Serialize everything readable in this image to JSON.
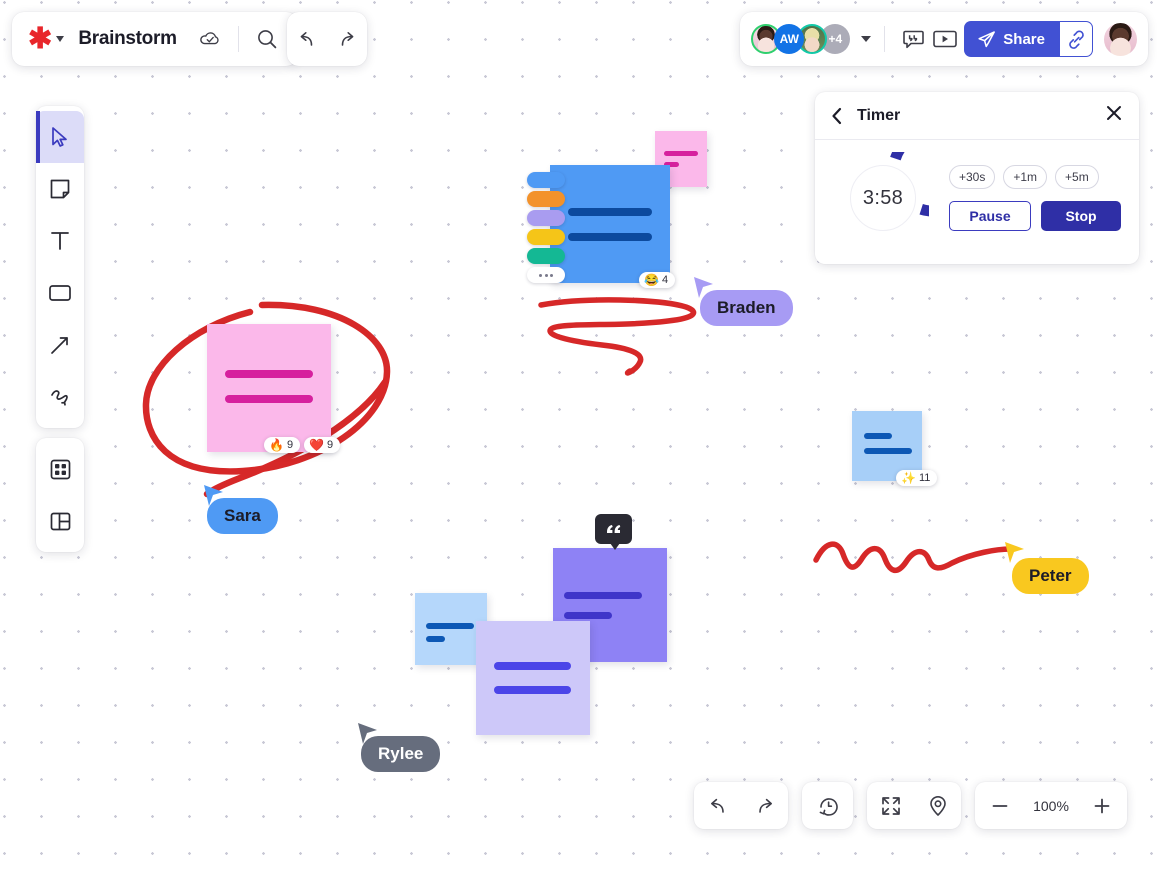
{
  "topbar": {
    "logo_icon": "asterisk-logo",
    "dropdown_icon": "chevron-down-icon",
    "title": "Brainstorm",
    "cloud_icon": "cloud-check-icon",
    "search_icon": "search-icon",
    "undo_icon": "undo-icon",
    "redo_icon": "redo-icon"
  },
  "collaborators": {
    "avatars": [
      {
        "name": "avatar-1",
        "initials": "",
        "type": "photo",
        "ring": "#2fcf6e"
      },
      {
        "name": "avatar-2",
        "initials": "AW",
        "type": "initials",
        "ring": "#1273e6"
      },
      {
        "name": "avatar-3",
        "initials": "",
        "type": "photo",
        "ring": "#12c9a8"
      },
      {
        "name": "avatar-more",
        "initials": "+4",
        "type": "count",
        "ring": "#acacb8"
      }
    ],
    "overflow_label": "+4",
    "dropdown_icon": "chevron-down-icon",
    "comment_icon": "comment-icon",
    "present_icon": "present-play-icon",
    "share_label": "Share",
    "share_icon": "paper-plane-icon",
    "link_icon": "link-icon",
    "share_color": "#4151d3",
    "me_avatar": "current-user-avatar"
  },
  "tools": {
    "primary": [
      {
        "name": "select-tool",
        "icon": "cursor-icon",
        "active": true
      },
      {
        "name": "sticky-note-tool",
        "icon": "sticky-note-icon",
        "active": false
      },
      {
        "name": "text-tool",
        "icon": "text-icon",
        "active": false
      },
      {
        "name": "shape-tool",
        "icon": "rectangle-icon",
        "active": false
      },
      {
        "name": "line-tool",
        "icon": "arrow-icon",
        "active": false
      },
      {
        "name": "pen-tool",
        "icon": "pen-scribble-icon",
        "active": false
      }
    ],
    "secondary": [
      {
        "name": "apps-tool",
        "icon": "grid-apps-icon"
      },
      {
        "name": "templates-tool",
        "icon": "template-layout-icon"
      }
    ]
  },
  "timer": {
    "back_icon": "chevron-left-icon",
    "title": "Timer",
    "close_icon": "close-icon",
    "value": "3:58",
    "ring_color": "#2f2fa6",
    "chips": [
      "+30s",
      "+1m",
      "+5m"
    ],
    "pause_label": "Pause",
    "stop_label": "Stop"
  },
  "canvas": {
    "reactions": [
      {
        "name": "reaction-laugh",
        "emoji": "😂",
        "count": "4"
      },
      {
        "name": "reaction-fire",
        "emoji": "🔥",
        "count": "9"
      },
      {
        "name": "reaction-heart",
        "emoji": "❤️",
        "count": "9"
      },
      {
        "name": "reaction-sparkle",
        "emoji": "✨",
        "count": "11"
      }
    ],
    "color_swatches": [
      "#4f9af4",
      "#f3922b",
      "#a99cf0",
      "#f5c518",
      "#14b894"
    ],
    "more_swatch_icon": "more-dots-icon",
    "comment_icon": "quote-comment-icon",
    "cursors": [
      {
        "name": "cursor-braden",
        "label": "Braden",
        "color": "#a79bf4",
        "text": "#1c1c28"
      },
      {
        "name": "cursor-sara",
        "label": "Sara",
        "color": "#4f9af4",
        "text": "#1c1c28"
      },
      {
        "name": "cursor-rylee",
        "label": "Rylee",
        "color": "#666d7d",
        "text": "#ffffff"
      },
      {
        "name": "cursor-peter",
        "label": "Peter",
        "color": "#f9c81f",
        "text": "#1c1c28"
      }
    ],
    "ink_color": "#d62828"
  },
  "bottombar": {
    "undo_icon": "undo-icon",
    "redo_icon": "redo-icon",
    "history_icon": "history-clock-icon",
    "fit_icon": "fit-screen-icon",
    "locate_icon": "map-pin-icon",
    "zoom_out_icon": "minus-icon",
    "zoom_level": "100%",
    "zoom_in_icon": "plus-icon"
  }
}
